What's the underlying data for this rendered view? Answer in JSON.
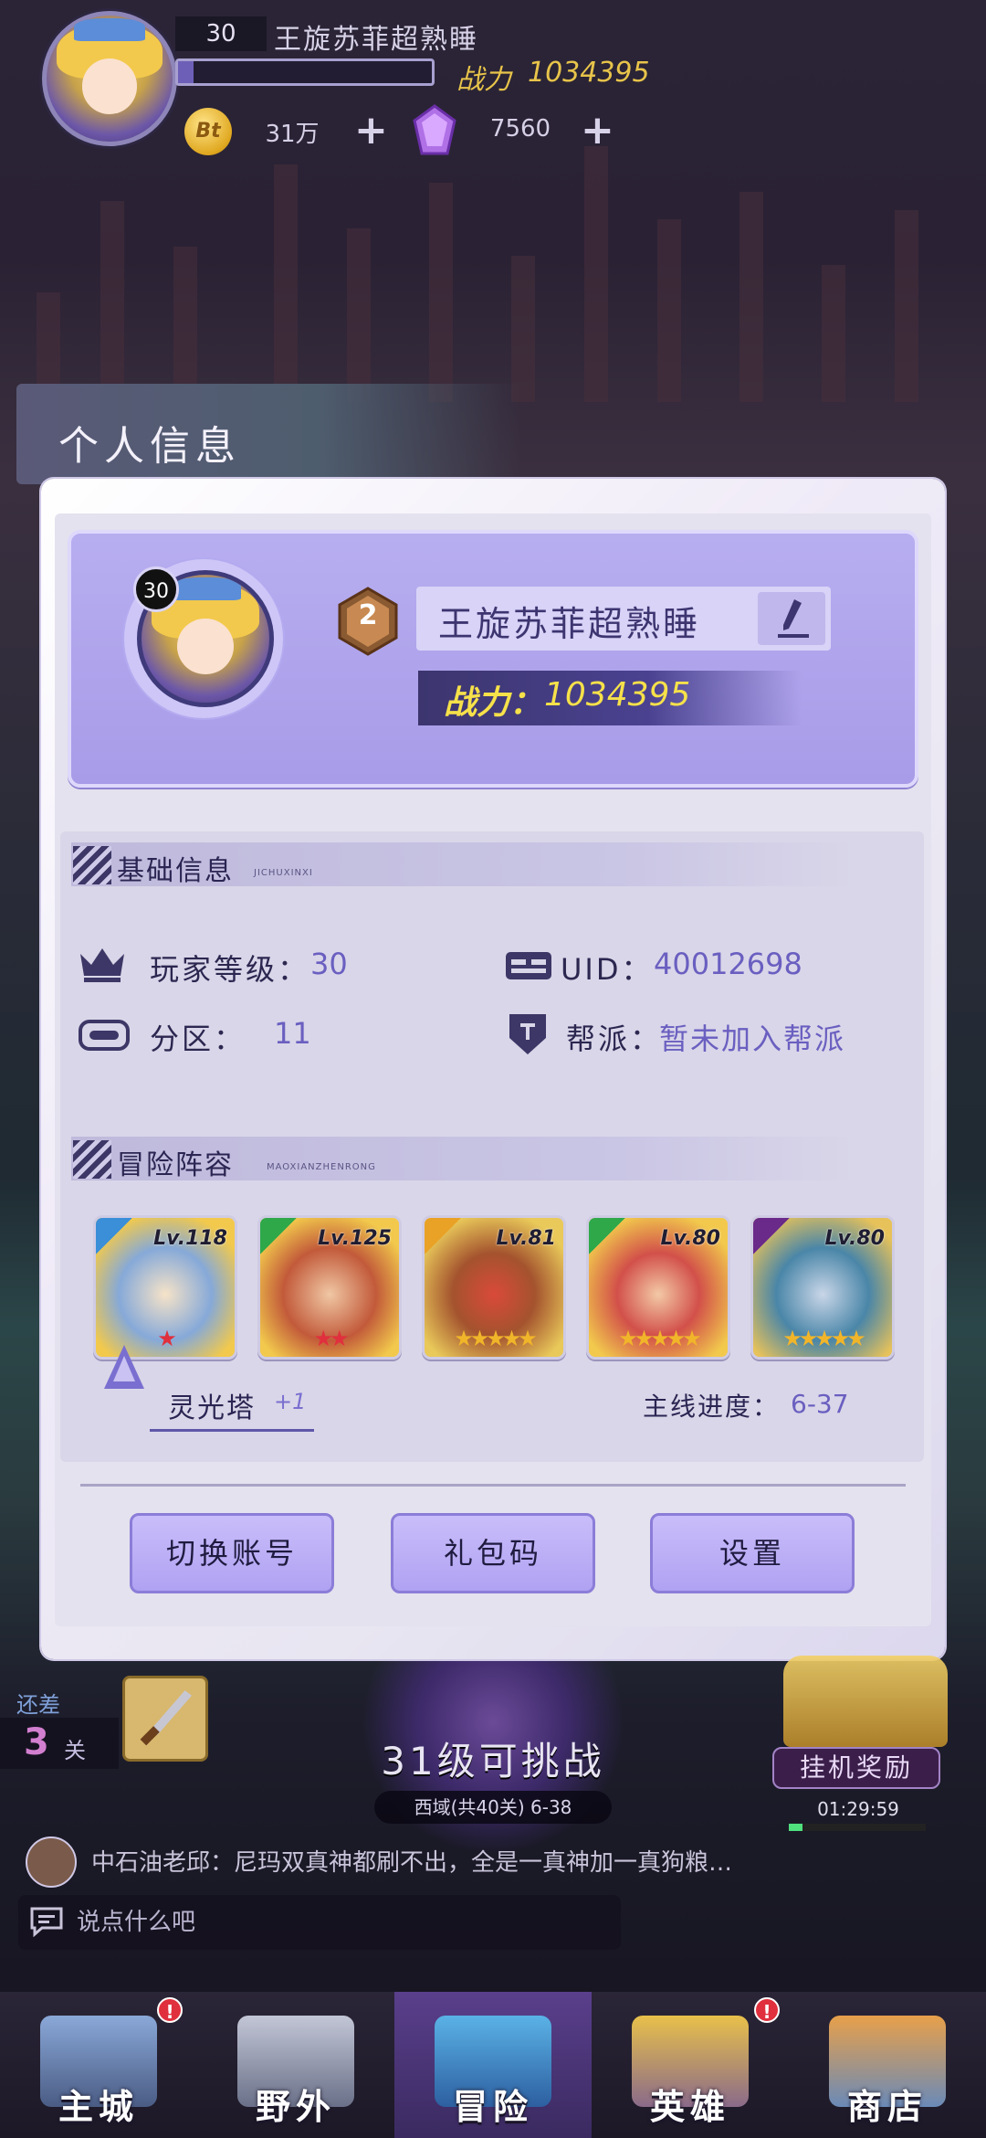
{
  "hud": {
    "level": "30",
    "player_name": "王旋苏菲超熟睡",
    "power_label": "战力",
    "power_value": "1034395",
    "coin_label": "Bt",
    "coin_value": "31万",
    "gem_value": "7560",
    "exp_fraction": 0.06
  },
  "side_tab": {
    "title": "个人信息"
  },
  "profile": {
    "level": "30",
    "rank": "2",
    "name": "王旋苏菲超熟睡",
    "power_label": "战力：",
    "power_value": "1034395"
  },
  "basic_info": {
    "title": "基础信息",
    "subtitle": "JICHUXINXI",
    "player_level_label": "玩家等级：",
    "player_level_value": "30",
    "uid_label": "UID：",
    "uid_value": "40012698",
    "server_label": "分区：",
    "server_value": "11",
    "guild_label": "帮派：",
    "guild_value": "暂未加入帮派"
  },
  "lineup": {
    "title": "冒险阵容",
    "subtitle": "MAOXIANZHENRONG",
    "heroes": [
      {
        "level": "Lv.118",
        "stars": "★",
        "star_color": "#e0303d",
        "element_color": "#3a8fd8"
      },
      {
        "level": "Lv.125",
        "stars": "★★",
        "star_color": "#e0303d",
        "element_color": "#2fa84a"
      },
      {
        "level": "Lv.81",
        "stars": "★★★★★",
        "star_color": "#f1b52a",
        "element_color": "#e9a226"
      },
      {
        "level": "Lv.80",
        "stars": "★★★★★",
        "star_color": "#f1b52a",
        "element_color": "#2fa84a"
      },
      {
        "level": "Lv.80",
        "stars": "★★★★★",
        "star_color": "#f1b52a",
        "element_color": "#6a2a8a"
      }
    ],
    "tower_label": "灵光塔",
    "tower_plus": "+1",
    "progress_label": "主线进度：",
    "progress_value": "6-37"
  },
  "buttons": {
    "switch_account": "切换账号",
    "gift_code": "礼包码",
    "settings": "设置"
  },
  "stage": {
    "remain_label": "还差",
    "remain_num": "3",
    "remain_unit": "关",
    "challenge_text": "31级可挑战",
    "stage_name": "西域(共40关) 6-38",
    "idle_reward": "挂机奖励",
    "idle_timer": "01:29:59"
  },
  "chat": {
    "message": "中石油老邱：尼玛双真神都刷不出，全是一真神加一真狗粮…",
    "input_placeholder": "说点什么吧"
  },
  "nav": {
    "items": [
      {
        "label": "主城",
        "badge": "!"
      },
      {
        "label": "野外",
        "badge": ""
      },
      {
        "label": "冒险",
        "badge": ""
      },
      {
        "label": "英雄",
        "badge": "!"
      },
      {
        "label": "商店",
        "badge": ""
      }
    ]
  },
  "colors": {
    "accent_purple": "#6a5fc0",
    "power_yellow": "#f6e14a",
    "button_fill": "#b0a2f2"
  }
}
